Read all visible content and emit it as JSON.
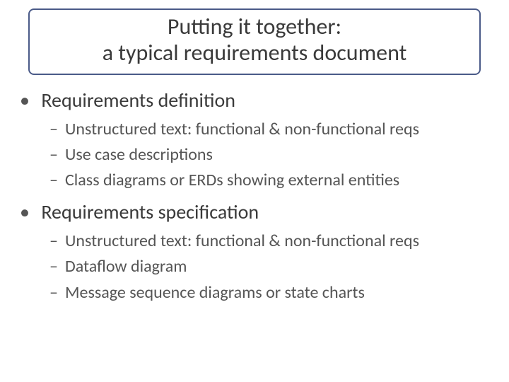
{
  "title_line1": "Putting it together:",
  "title_line2": "a typical requirements document",
  "sections": [
    {
      "heading": "Requirements definition",
      "items": [
        "Unstructured text: functional & non-functional reqs",
        "Use case descriptions",
        "Class diagrams or ERDs showing external entities"
      ]
    },
    {
      "heading": "Requirements specification",
      "items": [
        "Unstructured text: functional & non-functional reqs",
        "Dataflow diagram",
        "Message sequence diagrams or state charts"
      ]
    }
  ]
}
